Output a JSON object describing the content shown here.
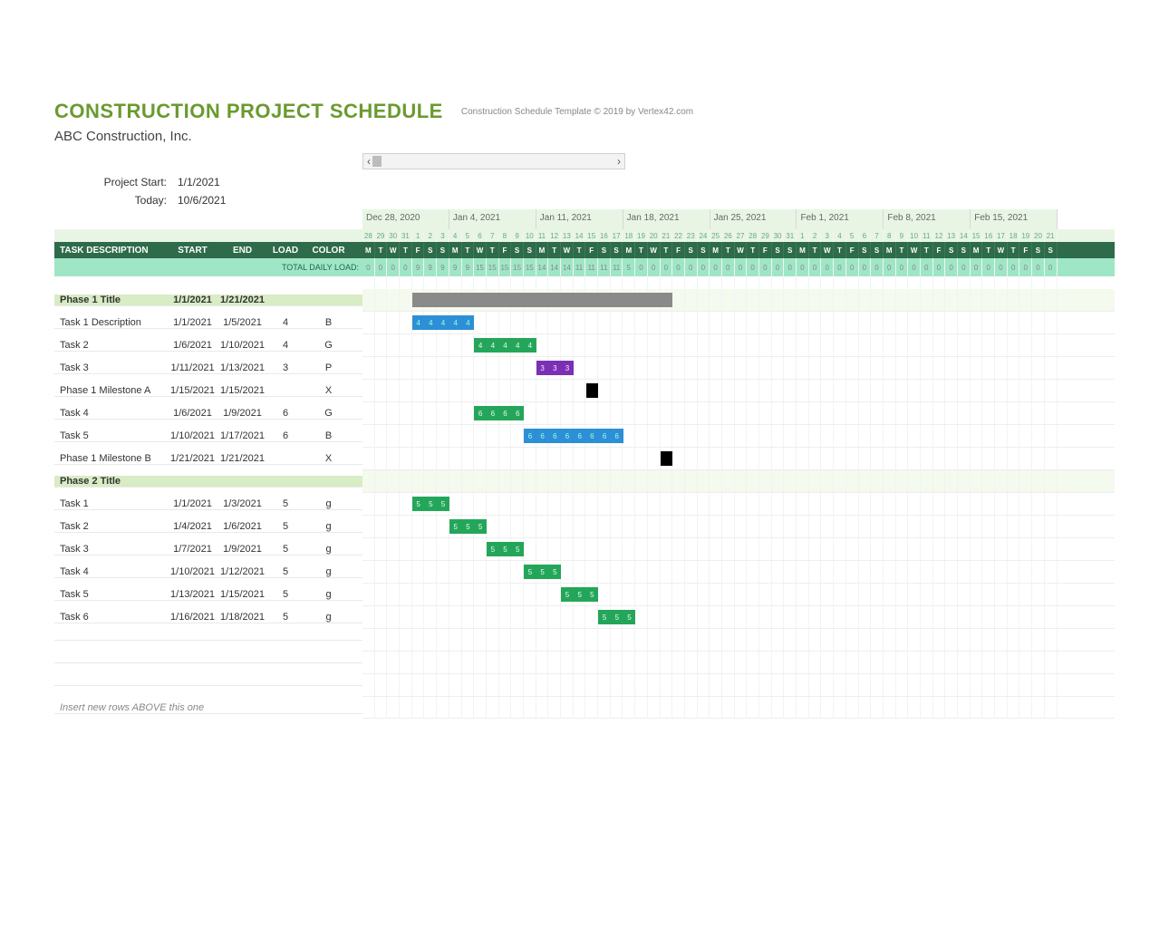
{
  "title": "CONSTRUCTION PROJECT SCHEDULE",
  "copyright": "Construction Schedule Template © 2019 by Vertex42.com",
  "company": "ABC Construction, Inc.",
  "meta": {
    "project_start_label": "Project Start:",
    "project_start": "1/1/2021",
    "today_label": "Today:",
    "today": "10/6/2021"
  },
  "columns": {
    "desc": "TASK DESCRIPTION",
    "start": "START",
    "end": "END",
    "load": "LOAD",
    "color": "COLOR"
  },
  "total_load_label": "TOTAL DAILY LOAD:",
  "footer_note": "Insert new rows ABOVE this one",
  "timeline": {
    "weeks": [
      "Dec 28, 2020",
      "Jan 4, 2021",
      "Jan 11, 2021",
      "Jan 18, 2021",
      "Jan 25, 2021",
      "Feb 1, 2021",
      "Feb 8, 2021",
      "Feb 15, 2021"
    ],
    "day_nums": [
      28,
      29,
      30,
      31,
      1,
      2,
      3,
      4,
      5,
      6,
      7,
      8,
      9,
      10,
      11,
      12,
      13,
      14,
      15,
      16,
      17,
      18,
      19,
      20,
      21,
      22,
      23,
      24,
      25,
      26,
      27,
      28,
      29,
      30,
      31,
      1,
      2,
      3,
      4,
      5,
      6,
      7,
      8,
      9,
      10,
      11,
      12,
      13,
      14,
      15,
      16,
      17,
      18,
      19,
      20,
      21
    ],
    "dow": [
      "M",
      "T",
      "W",
      "T",
      "F",
      "S",
      "S",
      "M",
      "T",
      "W",
      "T",
      "F",
      "S",
      "S",
      "M",
      "T",
      "W",
      "T",
      "F",
      "S",
      "S",
      "M",
      "T",
      "W",
      "T",
      "F",
      "S",
      "S",
      "M",
      "T",
      "W",
      "T",
      "F",
      "S",
      "S",
      "M",
      "T",
      "W",
      "T",
      "F",
      "S",
      "S",
      "M",
      "T",
      "W",
      "T",
      "F",
      "S",
      "S",
      "M",
      "T",
      "W",
      "T",
      "F",
      "S",
      "S"
    ],
    "daily_load": [
      0,
      0,
      0,
      0,
      9,
      9,
      9,
      9,
      9,
      15,
      15,
      15,
      15,
      15,
      14,
      14,
      14,
      11,
      11,
      11,
      11,
      5,
      0,
      0,
      0,
      0,
      0,
      0,
      0,
      0,
      0,
      0,
      0,
      0,
      0,
      0,
      0,
      0,
      0,
      0,
      0,
      0,
      0,
      0,
      0,
      0,
      0,
      0,
      0,
      0,
      0,
      0,
      0,
      0,
      0,
      0
    ]
  },
  "rows": [
    {
      "type": "phase",
      "desc": "Phase 1 Title",
      "start": "1/1/2021",
      "end": "1/21/2021",
      "bar": {
        "style": "gray",
        "offset": 4,
        "span": 21
      }
    },
    {
      "type": "task",
      "desc": "Task 1 Description",
      "start": "1/1/2021",
      "end": "1/5/2021",
      "load": "4",
      "color": "B",
      "bar": {
        "style": "blue",
        "offset": 4,
        "span": 5,
        "nums": [
          4,
          4,
          4,
          4,
          4
        ]
      }
    },
    {
      "type": "task",
      "desc": "Task 2",
      "start": "1/6/2021",
      "end": "1/10/2021",
      "load": "4",
      "color": "G",
      "bar": {
        "style": "green",
        "offset": 9,
        "span": 5,
        "nums": [
          4,
          4,
          4,
          4,
          4
        ]
      }
    },
    {
      "type": "task",
      "desc": "Task 3",
      "start": "1/11/2021",
      "end": "1/13/2021",
      "load": "3",
      "color": "P",
      "bar": {
        "style": "purple",
        "offset": 14,
        "span": 3,
        "nums": [
          3,
          3,
          3
        ]
      }
    },
    {
      "type": "task",
      "desc": "Phase 1 Milestone A",
      "start": "1/15/2021",
      "end": "1/15/2021",
      "load": "",
      "color": "X",
      "bar": {
        "style": "black",
        "offset": 18,
        "span": 1
      }
    },
    {
      "type": "task",
      "desc": "Task 4",
      "start": "1/6/2021",
      "end": "1/9/2021",
      "load": "6",
      "color": "G",
      "bar": {
        "style": "green",
        "offset": 9,
        "span": 4,
        "nums": [
          6,
          6,
          6,
          6
        ]
      }
    },
    {
      "type": "task",
      "desc": "Task 5",
      "start": "1/10/2021",
      "end": "1/17/2021",
      "load": "6",
      "color": "B",
      "bar": {
        "style": "blue",
        "offset": 13,
        "span": 8,
        "nums": [
          6,
          6,
          6,
          6,
          6,
          6,
          6,
          6
        ]
      }
    },
    {
      "type": "task",
      "desc": "Phase 1 Milestone B",
      "start": "1/21/2021",
      "end": "1/21/2021",
      "load": "",
      "color": "X",
      "bar": {
        "style": "black",
        "offset": 24,
        "span": 1
      }
    },
    {
      "type": "phase",
      "desc": "Phase 2 Title"
    },
    {
      "type": "task",
      "desc": "Task 1",
      "start": "1/1/2021",
      "end": "1/3/2021",
      "load": "5",
      "color": "g",
      "bar": {
        "style": "green",
        "offset": 4,
        "span": 3,
        "nums": [
          5,
          5,
          5
        ]
      }
    },
    {
      "type": "task",
      "desc": "Task 2",
      "start": "1/4/2021",
      "end": "1/6/2021",
      "load": "5",
      "color": "g",
      "bar": {
        "style": "green",
        "offset": 7,
        "span": 3,
        "nums": [
          5,
          5,
          5
        ]
      }
    },
    {
      "type": "task",
      "desc": "Task 3",
      "start": "1/7/2021",
      "end": "1/9/2021",
      "load": "5",
      "color": "g",
      "bar": {
        "style": "green",
        "offset": 10,
        "span": 3,
        "nums": [
          5,
          5,
          5
        ]
      }
    },
    {
      "type": "task",
      "desc": "Task 4",
      "start": "1/10/2021",
      "end": "1/12/2021",
      "load": "5",
      "color": "g",
      "bar": {
        "style": "green",
        "offset": 13,
        "span": 3,
        "nums": [
          5,
          5,
          5
        ]
      }
    },
    {
      "type": "task",
      "desc": "Task 5",
      "start": "1/13/2021",
      "end": "1/15/2021",
      "load": "5",
      "color": "g",
      "bar": {
        "style": "green",
        "offset": 16,
        "span": 3,
        "nums": [
          5,
          5,
          5
        ]
      }
    },
    {
      "type": "task",
      "desc": "Task 6",
      "start": "1/16/2021",
      "end": "1/18/2021",
      "load": "5",
      "color": "g",
      "bar": {
        "style": "green",
        "offset": 19,
        "span": 3,
        "nums": [
          5,
          5,
          5
        ]
      }
    },
    {
      "type": "blank"
    },
    {
      "type": "blank"
    },
    {
      "type": "blank"
    }
  ]
}
